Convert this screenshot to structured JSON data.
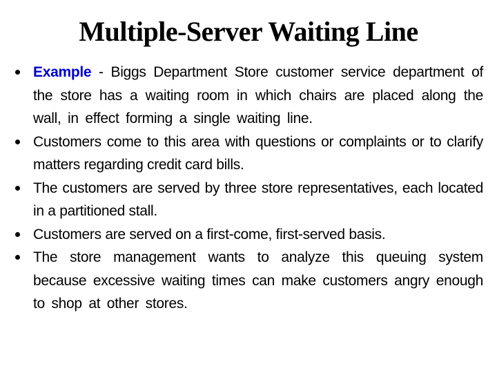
{
  "slide": {
    "title": "Multiple-Server Waiting Line",
    "accent_color": "#0000cc",
    "bullets": [
      {
        "highlight": "Example",
        "text": " - Biggs Department Store customer service department of the store has a waiting room in which chairs are placed along the wall, in effect forming a single waiting line."
      },
      {
        "text": "Customers come to this area with questions or complaints or to clarify matters regarding credit card bills."
      },
      {
        "text": "The customers are served by three store representatives, each located in a partitioned stall."
      },
      {
        "text": "Customers are served on a first-come, first-served basis."
      },
      {
        "text": "The store management wants to analyze this queuing system because excessive waiting times can make customers angry enough to shop at other stores."
      }
    ]
  }
}
